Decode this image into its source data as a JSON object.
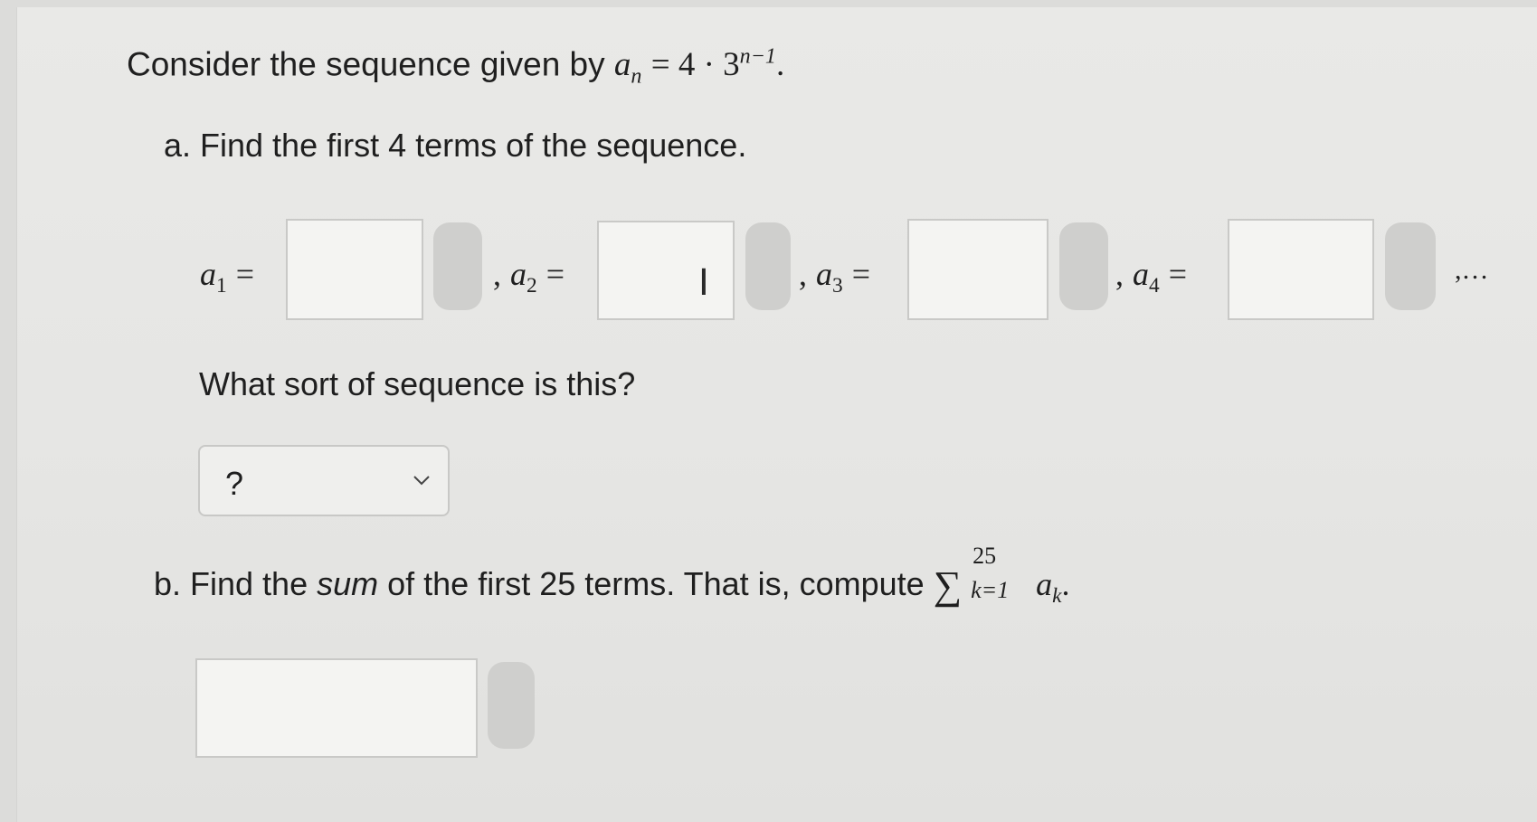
{
  "question": {
    "intro_text": "Consider the sequence given by",
    "formula_lhs": "a",
    "formula_lhs_sub": "n",
    "formula_rhs": "= 4 · 3",
    "formula_exp": "n−1",
    "formula_end": "."
  },
  "part_a": {
    "prompt": "a. Find the first 4 terms of the sequence.",
    "terms": [
      {
        "var": "a",
        "sub": "1",
        "eq": "=",
        "lead": "",
        "value": ""
      },
      {
        "var": "a",
        "sub": "2",
        "eq": "=",
        "lead": ",",
        "value": ""
      },
      {
        "var": "a",
        "sub": "3",
        "eq": "=",
        "lead": ",",
        "value": ""
      },
      {
        "var": "a",
        "sub": "4",
        "eq": "=",
        "lead": ",",
        "value": ""
      }
    ],
    "trailing": ",…",
    "sort_question": "What sort of sequence is this?",
    "sort_select": {
      "selected": "?"
    }
  },
  "part_b": {
    "prefix": "b. Find the ",
    "emph": "sum",
    "middle": " of the first 25 terms. That is, compute ",
    "sigma": "∑",
    "upper": "25",
    "lower": "k=1",
    "summand": "a",
    "summand_sub": "k",
    "end": ".",
    "answer_value": ""
  },
  "icons": {
    "text_cursor": "text-cursor-icon",
    "dropdown": "chevron-down-icon"
  }
}
